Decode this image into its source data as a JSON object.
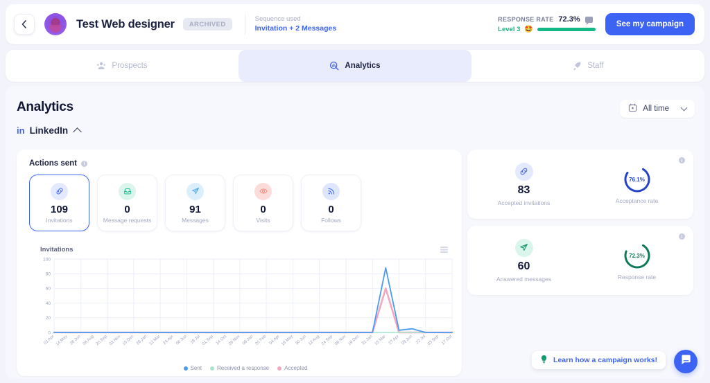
{
  "header": {
    "back_icon": "chevron-left-icon",
    "campaign_name": "Test Web designer",
    "archived_badge": "ARCHIVED",
    "sequence_label": "Sequence used",
    "sequence_value": "Invitation + 2 Messages",
    "response_rate_label": "RESPONSE RATE",
    "response_rate_value": "72.3%",
    "level_label": "Level 3",
    "level_emoji": "🤩",
    "cta_label": "See my campaign",
    "accent": "#3d63f5",
    "level_color": "#12b886"
  },
  "tabs": [
    {
      "label": "Prospects",
      "icon": "people-icon",
      "active": false
    },
    {
      "label": "Analytics",
      "icon": "analytics-icon",
      "active": true
    },
    {
      "label": "Staff",
      "icon": "rocket-icon",
      "active": false
    }
  ],
  "main": {
    "page_title": "Analytics",
    "network_logo": "in",
    "network_name": "LinkedIn",
    "collapse_icon": "chevron-up-icon",
    "date_filter": {
      "icon": "calendar-icon",
      "label": "All time",
      "caret": "chevron-down-icon"
    }
  },
  "actions_sent": {
    "title": "Actions sent",
    "info_icon": "info-icon",
    "tiles": [
      {
        "value": "109",
        "label": "Invitations",
        "icon": "link-icon",
        "icon_bg": "#e3e9fe",
        "icon_color": "#3d63f5",
        "selected": true
      },
      {
        "value": "0",
        "label": "Message requests",
        "icon": "inbox-icon",
        "icon_bg": "#d9f5ec",
        "icon_color": "#12b886",
        "selected": false
      },
      {
        "value": "91",
        "label": "Messages",
        "icon": "send-icon",
        "icon_bg": "#dbeefb",
        "icon_color": "#4aa8e0",
        "selected": false
      },
      {
        "value": "0",
        "label": "Visits",
        "icon": "eye-icon",
        "icon_bg": "#fcdcda",
        "icon_color": "#f08076",
        "selected": false
      },
      {
        "value": "0",
        "label": "Follows",
        "icon": "rss-icon",
        "icon_bg": "#dde6fd",
        "icon_color": "#3d63f5",
        "selected": false
      }
    ]
  },
  "stat_cards": [
    {
      "id": "accepted-invitations",
      "value": "83",
      "label": "Accepted invitations",
      "icon": "link-icon",
      "icon_bg": "#e3e9fe",
      "icon_color": "#3d63f5",
      "rate_value": "76.1%",
      "rate_label": "Acceptance rate",
      "rate_pct": 76.1,
      "rate_color": "#2443c9",
      "info_icon": "info-icon"
    },
    {
      "id": "answered-messages",
      "value": "60",
      "label": "Answered messages",
      "icon": "send-icon",
      "icon_bg": "#d9f5ec",
      "icon_color": "#12916a",
      "rate_value": "72.3%",
      "rate_label": "Response rate",
      "rate_pct": 72.3,
      "rate_color": "#0f7a59",
      "info_icon": "info-icon"
    }
  ],
  "chart_data": {
    "type": "line",
    "title": "Invitations",
    "xlabel": "",
    "ylabel": "",
    "ylim": [
      0,
      100
    ],
    "yticks": [
      0,
      20,
      40,
      60,
      80,
      100
    ],
    "grid": true,
    "legend_position": "bottom",
    "menu_icon": "chart-menu-icon",
    "categories": [
      "01 Apr",
      "14 May",
      "26 Jun",
      "08 Aug",
      "20 Sep",
      "02 Nov",
      "15 Dec",
      "28 Jan",
      "12 Mar",
      "24 Apr",
      "06 Jun",
      "19 Jul",
      "01 Sep",
      "14 Oct",
      "26 Nov",
      "08 Jan",
      "20 Feb",
      "04 Apr",
      "18 May",
      "30 Jun",
      "12 Aug",
      "24 Sep",
      "06 Nov",
      "19 Dec",
      "31 Jan",
      "15 Mar",
      "27 Apr",
      "09 Jun",
      "22 Jul",
      "03 Sep",
      "17 Oct"
    ],
    "series": [
      {
        "name": "Sent",
        "color": "#4a9bf0",
        "values": [
          0,
          0,
          0,
          0,
          0,
          0,
          0,
          0,
          0,
          0,
          0,
          0,
          0,
          0,
          0,
          0,
          0,
          0,
          0,
          0,
          0,
          0,
          0,
          0,
          0,
          88,
          3,
          5,
          0,
          0,
          0
        ]
      },
      {
        "name": "Received a response",
        "color": "#a8e6cf",
        "values": [
          0,
          0,
          0,
          0,
          0,
          0,
          0,
          0,
          0,
          0,
          0,
          0,
          0,
          0,
          0,
          0,
          0,
          0,
          0,
          0,
          0,
          0,
          0,
          0,
          0,
          0,
          0,
          0,
          0,
          0,
          0
        ]
      },
      {
        "name": "Accepted",
        "color": "#f3a8c0",
        "values": [
          0,
          0,
          0,
          0,
          0,
          0,
          0,
          0,
          0,
          0,
          0,
          0,
          0,
          0,
          0,
          0,
          0,
          0,
          0,
          0,
          0,
          0,
          0,
          0,
          0,
          60,
          0,
          0,
          0,
          0,
          0
        ]
      }
    ]
  },
  "footer": {
    "learn_icon": "lightbulb-icon",
    "learn_label": "Learn how a campaign works!",
    "chat_icon": "chat-bubble-icon"
  }
}
